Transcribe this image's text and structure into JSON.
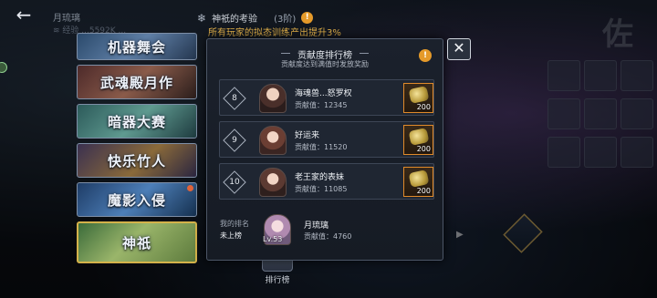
{
  "header": {
    "back_icon": "back-arrow-icon",
    "player_name": "月琉璃",
    "player_sub": "≋ 经验 ...5592K  ...",
    "event_icon": "snowflake-icon",
    "event_title": "神祇的考验",
    "event_count": "(3阶)",
    "event_warn": "!",
    "event_desc": "所有玩家的拟态训练产出提升3%"
  },
  "event_cards": [
    {
      "label": "机器舞会",
      "selected": false,
      "notify": false
    },
    {
      "label": "武魂殿月作",
      "selected": false,
      "notify": false
    },
    {
      "label": "暗器大赛",
      "selected": false,
      "notify": false
    },
    {
      "label": "快乐竹人",
      "selected": false,
      "notify": false
    },
    {
      "label": "魔影入侵",
      "selected": false,
      "notify": true
    },
    {
      "label": "神祇",
      "selected": true,
      "notify": false
    }
  ],
  "bottom_tab": {
    "label": "排行榜"
  },
  "modal": {
    "title": "贡献度排行榜",
    "subtitle": "贡献度达到满值时发放奖励",
    "info": "!",
    "close": "✕",
    "rows": [
      {
        "rank": "8",
        "name": "海魂兽...怒罗权",
        "score": "贡献值：12345",
        "reward_qty": "200"
      },
      {
        "rank": "9",
        "name": "好运来",
        "score": "贡献值：11520",
        "reward_qty": "200"
      },
      {
        "rank": "10",
        "name": "老王家的表妹",
        "score": "贡献值：11085",
        "reward_qty": "200"
      }
    ],
    "me": {
      "label": "我的排名",
      "rank": "未上榜",
      "level": "Lv.53",
      "name": "月琉璃",
      "score": "贡献值：4760"
    }
  },
  "colors": {
    "accent": "#e59a2a",
    "highlight": "#e8b54b",
    "reward_border": "#e08a2a"
  }
}
